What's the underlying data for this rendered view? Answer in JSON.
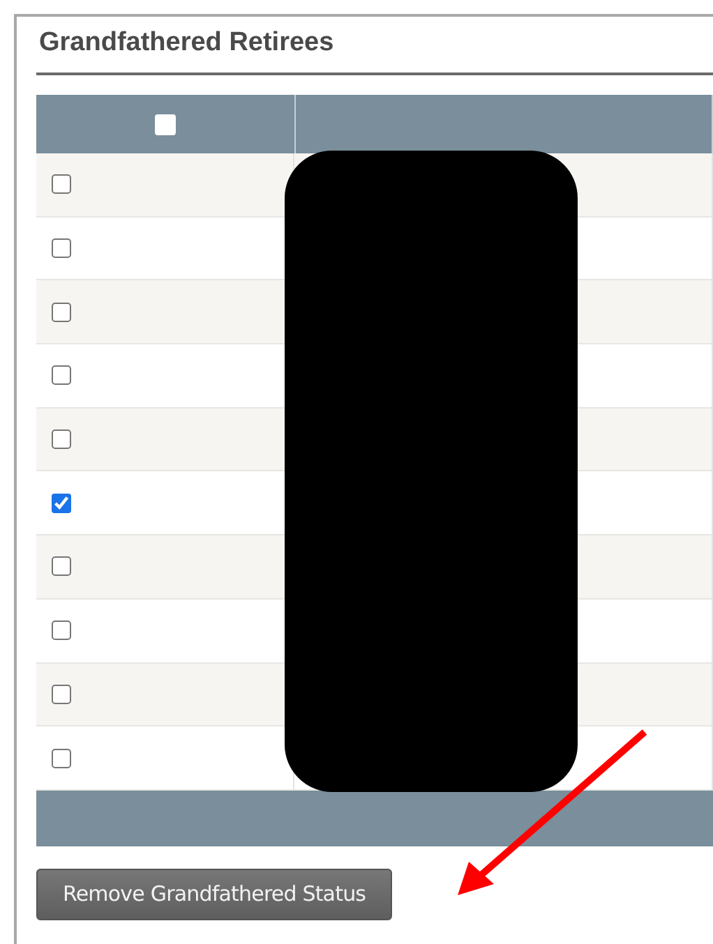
{
  "panel": {
    "title": "Grandfathered Retirees"
  },
  "table": {
    "header_checkbox": {
      "checked": false
    },
    "rows": [
      {
        "checked": false
      },
      {
        "checked": false
      },
      {
        "checked": false
      },
      {
        "checked": false
      },
      {
        "checked": false
      },
      {
        "checked": true
      },
      {
        "checked": false
      },
      {
        "checked": false
      },
      {
        "checked": false
      },
      {
        "checked": false
      }
    ]
  },
  "button": {
    "label": "Remove Grandfathered Status"
  }
}
